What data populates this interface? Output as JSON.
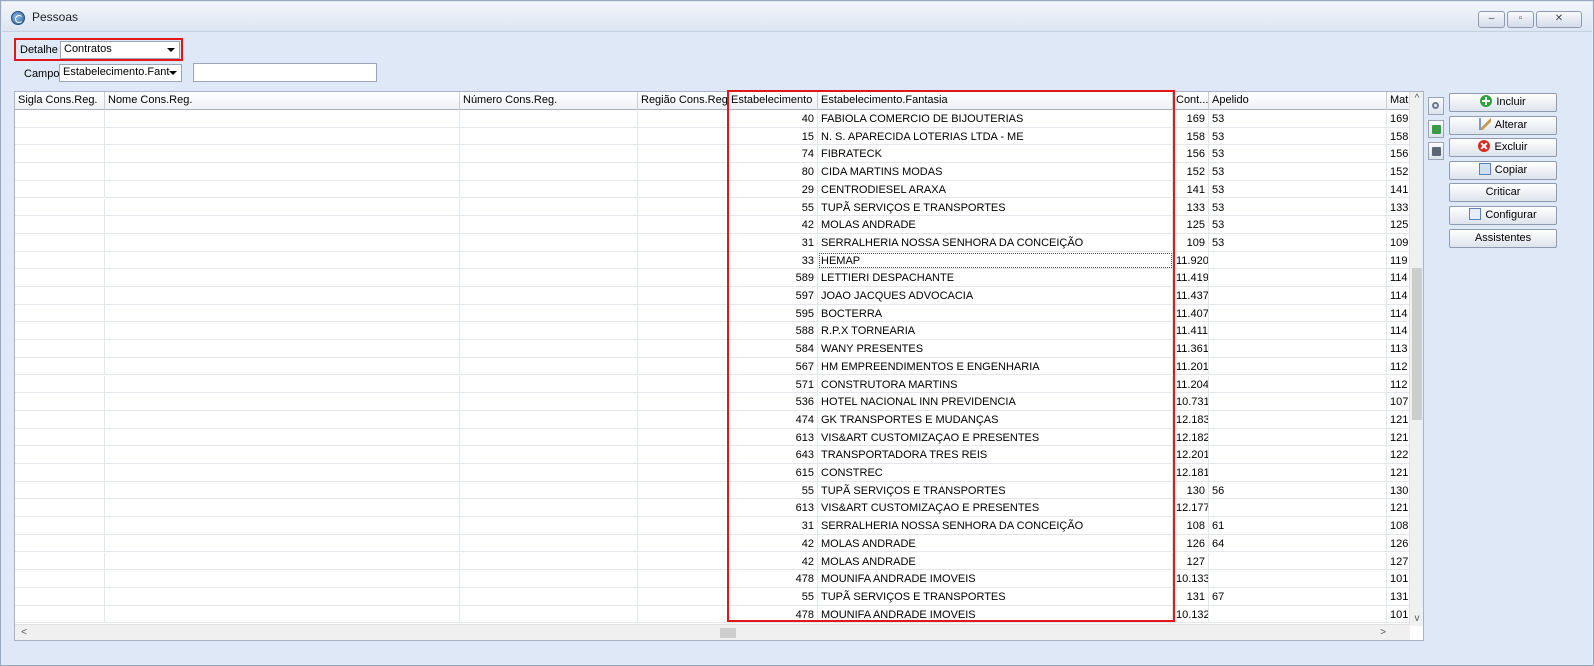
{
  "window": {
    "title": "Pessoas",
    "controls": {
      "minimize": "–",
      "maximize": "▫",
      "close": "✕"
    }
  },
  "filters": {
    "detalhe_label": "Detalhe",
    "detalhe_value": "Contratos",
    "campo_label": "Campo",
    "campo_value": "Estabelecimento.Fant",
    "search_value": ""
  },
  "grid": {
    "columns": [
      "Sigla Cons.Reg.",
      "Nome Cons.Reg.",
      "Número Cons.Reg.",
      "Região Cons.Reg.",
      "Estabelecimento",
      "Estabelecimento.Fantasia",
      "Cont...",
      "Apelido",
      "Mat"
    ],
    "rows": [
      [
        "40",
        "FABIOLA COMERCIO DE BIJOUTERIAS",
        "169",
        "53",
        "169"
      ],
      [
        "15",
        "N. S. APARECIDA  LOTERIAS LTDA - ME",
        "158",
        "53",
        "158"
      ],
      [
        "74",
        "FIBRATECK",
        "156",
        "53",
        "156"
      ],
      [
        "80",
        "CIDA MARTINS MODAS",
        "152",
        "53",
        "152"
      ],
      [
        "29",
        "CENTRODIESEL ARAXA",
        "141",
        "53",
        "141"
      ],
      [
        "55",
        "TUPÃ  SERVIÇOS E TRANSPORTES",
        "133",
        "53",
        "133"
      ],
      [
        "42",
        "MOLAS ANDRADE",
        "125",
        "53",
        "125"
      ],
      [
        "31",
        "SERRALHERIA NOSSA SENHORA DA CONCEIÇÃO",
        "109",
        "53",
        "109"
      ],
      [
        "33",
        "HEMAP",
        "11.920",
        "",
        "119"
      ],
      [
        "589",
        "LETTIERI DESPACHANTE",
        "11.419",
        "",
        "114"
      ],
      [
        "597",
        "JOAO JACQUES ADVOCACIA",
        "11.437",
        "",
        "114"
      ],
      [
        "595",
        "BOCTERRA",
        "11.407",
        "",
        "114"
      ],
      [
        "588",
        "R.P.X TORNEARIA",
        "11.411",
        "",
        "114"
      ],
      [
        "584",
        "WANY PRESENTES",
        "11.361",
        "",
        "113"
      ],
      [
        "567",
        "HM EMPREENDIMENTOS E ENGENHARIA",
        "11.201",
        "",
        "112"
      ],
      [
        "571",
        "CONSTRUTORA MARTINS",
        "11.204",
        "",
        "112"
      ],
      [
        "536",
        "HOTEL NACIONAL INN PREVIDENCIA",
        "10.731",
        "",
        "107"
      ],
      [
        "474",
        "GK TRANSPORTES E MUDANÇAS",
        "12.183",
        "",
        "121"
      ],
      [
        "613",
        "VIS&ART CUSTOMIZAÇAO E PRESENTES",
        "12.182",
        "",
        "121"
      ],
      [
        "643",
        "TRANSPORTADORA TRES REIS",
        "12.201",
        "",
        "122"
      ],
      [
        "615",
        "CONSTREC",
        "12.181",
        "",
        "121"
      ],
      [
        "55",
        "TUPÃ  SERVIÇOS E TRANSPORTES",
        "130",
        "56",
        "130"
      ],
      [
        "613",
        "VIS&ART CUSTOMIZAÇAO E PRESENTES",
        "12.177",
        "",
        "121"
      ],
      [
        "31",
        "SERRALHERIA NOSSA SENHORA DA CONCEIÇÃO",
        "108",
        "61",
        "108"
      ],
      [
        "42",
        "MOLAS ANDRADE",
        "126",
        "64",
        "126"
      ],
      [
        "42",
        "MOLAS ANDRADE",
        "127",
        "",
        "127"
      ],
      [
        "478",
        "MOUNIFA ANDRADE IMOVEIS",
        "10.133",
        "",
        "101"
      ],
      [
        "55",
        "TUPÃ  SERVIÇOS E TRANSPORTES",
        "131",
        "67",
        "131"
      ],
      [
        "478",
        "MOUNIFA ANDRADE IMOVEIS",
        "10.132",
        "",
        "101"
      ]
    ],
    "scroll": {
      "up": "^",
      "down": "v",
      "left": "<",
      "right": ">"
    }
  },
  "actions": {
    "incluir": "Incluir",
    "alterar": "Alterar",
    "excluir": "Excluir",
    "copiar": "Copiar",
    "criticar": "Criticar",
    "configurar": "Configurar",
    "assistentes": "Assistentes"
  },
  "colors": {
    "highlight": "#e0171b",
    "window_bg": "#dfe8f6"
  }
}
